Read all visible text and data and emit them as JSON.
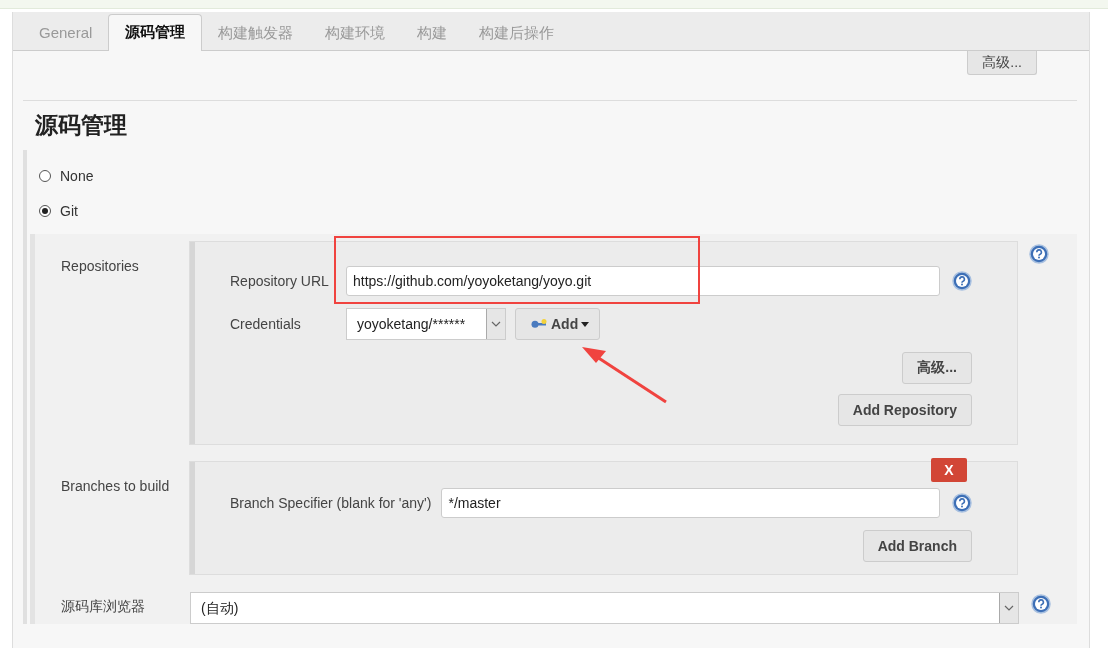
{
  "tabs": [
    {
      "label": "General",
      "selected": false
    },
    {
      "label": "源码管理",
      "selected": true
    },
    {
      "label": "构建触发器",
      "selected": false
    },
    {
      "label": "构建环境",
      "selected": false
    },
    {
      "label": "构建",
      "selected": false
    },
    {
      "label": "构建后操作",
      "selected": false
    }
  ],
  "advanced_button": "高级...",
  "section_title": "源码管理",
  "scm_options": [
    {
      "label": "None",
      "selected": false
    },
    {
      "label": "Git",
      "selected": true
    }
  ],
  "repositories": {
    "label": "Repositories",
    "url_label": "Repository URL",
    "url_value": "https://github.com/yoyoketang/yoyo.git",
    "credentials_label": "Credentials",
    "credentials_value": "yoyoketang/******",
    "add_button": "Add",
    "advanced_button": "高级...",
    "add_repository_button": "Add Repository"
  },
  "branches": {
    "label": "Branches to build",
    "delete_button": "X",
    "specifier_label": "Branch Specifier (blank for 'any')",
    "specifier_value": "*/master",
    "add_branch_button": "Add Branch"
  },
  "repository_browser": {
    "label": "源码库浏览器",
    "value": "(自动)"
  }
}
